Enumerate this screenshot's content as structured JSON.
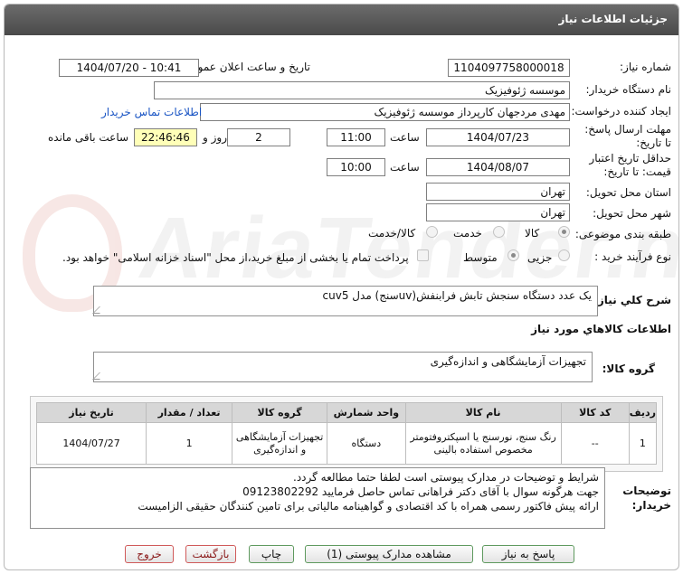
{
  "title": "جزئیات اطلاعات نیاز",
  "watermark": "AriaTender.neT",
  "need_number": {
    "label": "شماره نیاز:",
    "value": "1104097758000018"
  },
  "announce": {
    "label": "تاریخ و ساعت اعلان عمومی:",
    "value": "1404/07/20 - 10:41"
  },
  "buyer": {
    "label": "نام دستگاه خریدار:",
    "value": "موسسه ژئوفیزیک"
  },
  "creator": {
    "label": "ایجاد کننده درخواست:",
    "value": "مهدی مردجهان کارپرداز موسسه ژئوفیزیک",
    "contact_link": "اطلاعات تماس خریدار"
  },
  "deadline": {
    "label": "مهلت ارسال پاسخ: تا تاریخ:",
    "date": "1404/07/23",
    "time_label": "ساعت",
    "time": "11:00",
    "days": "2",
    "days_label": "روز و",
    "remaining": "22:46:46",
    "remaining_label": "ساعت باقی مانده"
  },
  "validity": {
    "label": "حداقل تاریخ اعتبار قیمت: تا تاریخ:",
    "date": "1404/08/07",
    "time_label": "ساعت",
    "time": "10:00"
  },
  "province": {
    "label": "استان محل تحویل:",
    "value": "تهران"
  },
  "city": {
    "label": "شهر محل تحویل:",
    "value": "تهران"
  },
  "category": {
    "label": "طبقه بندی موضوعی:",
    "options": [
      "کالا",
      "خدمت",
      "کالا/خدمت"
    ],
    "selected": "کالا"
  },
  "process": {
    "label": "نوع فرآیند خرید :",
    "options": [
      "جزیی",
      "متوسط"
    ],
    "selected": "متوسط",
    "payment_note": "پرداخت تمام یا بخشی از مبلغ خرید،از محل \"اسناد خزانه اسلامی\" خواهد بود."
  },
  "need_desc": {
    "label": "شرح کلي نياز:",
    "value": "یک عدد دستگاه سنجش تابش فرابنفش(uvسنج) مدل cuv5"
  },
  "goods_info_heading": "اطلاعات کالاهاي مورد نياز",
  "goods_group": {
    "label": "گروه کالا:",
    "value": "تجهیزات آزمایشگاهی و اندازه‌گیری"
  },
  "table": {
    "headers": [
      "ردیف",
      "کد کالا",
      "نام کالا",
      "واحد شمارش",
      "گروه کالا",
      "تعداد / مقدار",
      "تاریخ نیاز"
    ],
    "rows": [
      [
        "1",
        "--",
        "رنگ سنج، نورسنج یا اسپکتروفتومتر مخصوص استفاده بالینی",
        "دستگاه",
        "تجهیزات آزمایشگاهی و اندازه‌گیری",
        "1",
        "1404/07/27"
      ]
    ]
  },
  "buyer_notes": {
    "label": "توضیحات خریدار:",
    "lines": [
      "شرایط و توضیحات در مدارک پیوستی است لطفا حتما مطالعه گردد.",
      "جهت هرگونه سوال با آقای دکتر فراهانی تماس حاصل فرمایید 09123802292",
      "ارائه پیش فاکتور رسمی همراه با کد اقتصادی و گواهینامه مالیاتی برای تامین کنندگان حقیقی الزامیست"
    ]
  },
  "buttons": {
    "reply": "پاسخ به نیاز",
    "attachments": "مشاهده مدارک پیوستی (1)",
    "print": "چاپ",
    "back": "بازگشت",
    "exit": "خروج"
  }
}
